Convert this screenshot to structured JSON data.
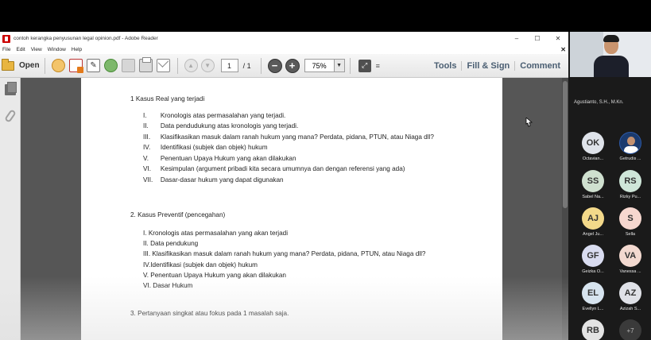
{
  "window": {
    "title": "contoh kerangka penyusunan legal opinion.pdf - Adobe Reader",
    "controls": [
      "–",
      "☐",
      "✕"
    ]
  },
  "menu": {
    "items": [
      "File",
      "Edit",
      "View",
      "Window",
      "Help"
    ],
    "close": "✕"
  },
  "toolbar": {
    "open_label": "Open",
    "page_current": "1",
    "page_total": "/ 1",
    "zoom": "75%",
    "zoom_minus": "−",
    "zoom_plus": "+",
    "tabs": [
      "Tools",
      "Fill & Sign",
      "Comment"
    ]
  },
  "document": {
    "lines": [
      {
        "num": "",
        "text": "1 Kasus Real yang terjadi"
      },
      {
        "num": "I.",
        "text": "Kronologis atas permasalahan yang terjadi."
      },
      {
        "num": "II.",
        "text": "Data pendudukung atas kronologis yang terjadi."
      },
      {
        "num": "III.",
        "text": "Klasifikasikan masuk dalam ranah hukum yang mana? Perdata, pidana, PTUN, atau Niaga dll?"
      },
      {
        "num": "IV.",
        "text": "Identifikasi (subjek dan objek) hukum"
      },
      {
        "num": "V.",
        "text": "Penentuan Upaya Hukum yang akan dilakukan"
      },
      {
        "num": "VI.",
        "text": "Kesimpulan (argument pribadi kita secara umumnya dan dengan referensi yang ada)"
      },
      {
        "num": "VII.",
        "text": "Dasar-dasar hukum yang dapat digunakan"
      },
      {
        "num": "",
        "text": "2. Kasus Preventif (pencegahan)"
      },
      {
        "num": "",
        "text": "I. Kronologis atas permasalahan yang akan terjadi"
      },
      {
        "num": "",
        "text": "II. Data pendukung"
      },
      {
        "num": "",
        "text": "III. Klasifikasikan masuk dalam ranah hukum yang mana? Perdata, pidana, PTUN, atau Niaga dll?"
      },
      {
        "num": "",
        "text": "IV.Identifikasi (subjek dan objek) hukum"
      },
      {
        "num": "",
        "text": "V. Penentuan Upaya Hukum yang akan dilakukan"
      },
      {
        "num": "",
        "text": "VI. Dasar Hukum"
      },
      {
        "num": "",
        "text": "3.  Pertanyaan singkat atau fokus pada 1 masalah saja."
      }
    ]
  },
  "meeting": {
    "speaker_name": "Agustianto, S.H., M.Kn.",
    "participants": [
      {
        "initials": "OK",
        "name": "Octavian...",
        "color": "#dfe3ea"
      },
      {
        "initials": "",
        "name": "Getrudis ...",
        "color": "#1a3a6e",
        "photo": true
      },
      {
        "initials": "SS",
        "name": "Sabel Na...",
        "color": "#cfe0cf"
      },
      {
        "initials": "RS",
        "name": "Rizky Pu...",
        "color": "#cfe6d9"
      },
      {
        "initials": "AJ",
        "name": "Angel Ju...",
        "color": "#f3d98a"
      },
      {
        "initials": "S",
        "name": "Sella",
        "color": "#f6d7cf"
      },
      {
        "initials": "GF",
        "name": "Geizka O...",
        "color": "#d9dcf0"
      },
      {
        "initials": "VA",
        "name": "Vanessa ...",
        "color": "#f3d9d0"
      },
      {
        "initials": "EL",
        "name": "Evellyn L...",
        "color": "#d7e4ef"
      },
      {
        "initials": "AZ",
        "name": "Azizah S...",
        "color": "#dfe1e7"
      },
      {
        "initials": "RB",
        "name": "",
        "color": "#e3e3e3"
      }
    ],
    "more_count": "+7"
  }
}
